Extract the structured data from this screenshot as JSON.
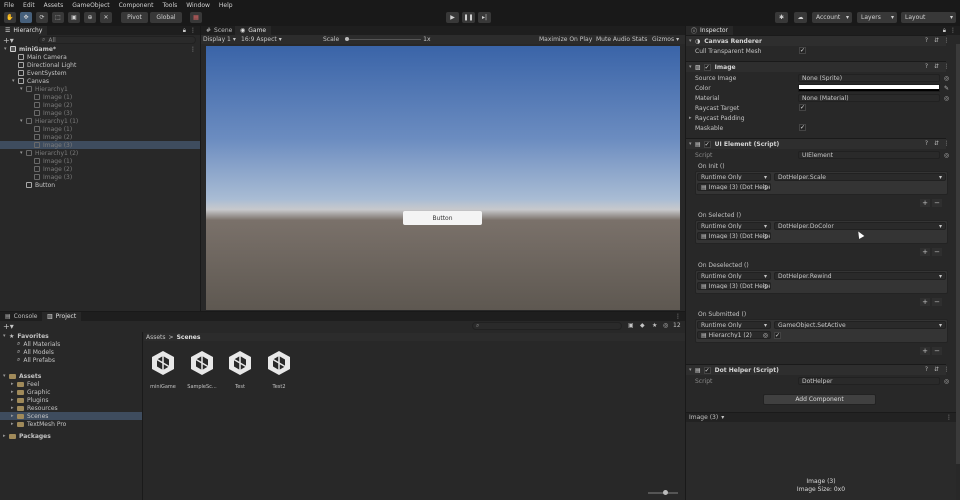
{
  "menu": [
    "File",
    "Edit",
    "Assets",
    "GameObject",
    "Component",
    "Tools",
    "Window",
    "Help"
  ],
  "toolbar": {
    "pivot": "Pivot",
    "global": "Global",
    "account": "Account",
    "layers": "Layers",
    "layout": "Layout"
  },
  "hierarchy": {
    "tab": "Hierarchy",
    "search_placeholder": "All",
    "items": [
      {
        "label": "miniGame*",
        "level": 0,
        "kind": "scene"
      },
      {
        "label": "Main Camera",
        "level": 1,
        "kind": "go"
      },
      {
        "label": "Directional Light",
        "level": 1,
        "kind": "go"
      },
      {
        "label": "EventSystem",
        "level": 1,
        "kind": "go"
      },
      {
        "label": "Canvas",
        "level": 1,
        "kind": "go"
      },
      {
        "label": "Hierarchy1",
        "level": 2,
        "kind": "dim"
      },
      {
        "label": "Image (1)",
        "level": 3,
        "kind": "dim"
      },
      {
        "label": "Image (2)",
        "level": 3,
        "kind": "dim"
      },
      {
        "label": "Image (3)",
        "level": 3,
        "kind": "dim"
      },
      {
        "label": "Hierarchy1 (1)",
        "level": 2,
        "kind": "dim"
      },
      {
        "label": "Image (1)",
        "level": 3,
        "kind": "dim"
      },
      {
        "label": "Image (2)",
        "level": 3,
        "kind": "dim"
      },
      {
        "label": "Image (3)",
        "level": 3,
        "kind": "dimsel"
      },
      {
        "label": "Hierarchy1 (2)",
        "level": 2,
        "kind": "dim"
      },
      {
        "label": "Image (1)",
        "level": 3,
        "kind": "dim"
      },
      {
        "label": "Image (2)",
        "level": 3,
        "kind": "dim"
      },
      {
        "label": "Image (3)",
        "level": 3,
        "kind": "dim"
      },
      {
        "label": "Button",
        "level": 2,
        "kind": "go"
      }
    ]
  },
  "view": {
    "tab_scene": "Scene",
    "tab_game": "Game",
    "display": "Display 1",
    "aspect": "16:9 Aspect",
    "scale_label": "Scale",
    "scale_value": "1x",
    "maximize": "Maximize On Play",
    "mute": "Mute Audio",
    "stats": "Stats",
    "gizmos": "Gizmos",
    "button_label": "Button"
  },
  "bottom": {
    "tab_console": "Console",
    "tab_project": "Project",
    "badge": "12",
    "breadcrumb_root": "Assets",
    "breadcrumb_sep": ">",
    "breadcrumb_current": "Scenes",
    "tree": [
      {
        "label": "Favorites",
        "level": 0,
        "kind": "star"
      },
      {
        "label": "All Materials",
        "level": 1,
        "kind": "search"
      },
      {
        "label": "All Models",
        "level": 1,
        "kind": "search"
      },
      {
        "label": "All Prefabs",
        "level": 1,
        "kind": "search"
      },
      {
        "label": "Assets",
        "level": 0,
        "kind": "folder"
      },
      {
        "label": "Feel",
        "level": 1,
        "kind": "folder"
      },
      {
        "label": "Graphic",
        "level": 1,
        "kind": "folder"
      },
      {
        "label": "Plugins",
        "level": 1,
        "kind": "folder"
      },
      {
        "label": "Resources",
        "level": 1,
        "kind": "folder"
      },
      {
        "label": "Scenes",
        "level": 1,
        "kind": "foldersel"
      },
      {
        "label": "TextMesh Pro",
        "level": 1,
        "kind": "folder"
      },
      {
        "label": "Packages",
        "level": 0,
        "kind": "folder"
      }
    ],
    "assets": [
      "miniGame",
      "SampleSc...",
      "Test",
      "Test2"
    ]
  },
  "inspector": {
    "tab": "Inspector",
    "canvas_renderer": "Canvas Renderer",
    "cull_label": "Cull Transparent Mesh",
    "image_title": "Image",
    "source_image_label": "Source Image",
    "source_image_value": "None (Sprite)",
    "color_label": "Color",
    "material_label": "Material",
    "material_value": "None (Material)",
    "raycast_target": "Raycast Target",
    "raycast_padding": "Raycast Padding",
    "maskable": "Maskable",
    "ui_element_title": "UI Element (Script)",
    "script_label": "Script",
    "ui_script_value": "UIElement",
    "events": [
      {
        "label": "On Init ()",
        "mode": "Runtime Only",
        "func": "DotHelper.Scale",
        "target": "Image (3) (Dot Helpe"
      },
      {
        "label": "On Selected ()",
        "mode": "Runtime Only",
        "func": "DotHelper.DoColor",
        "target": "Image (3) (Dot Helpe"
      },
      {
        "label": "On Deselected ()",
        "mode": "Runtime Only",
        "func": "DotHelper.Rewind",
        "target": "Image (3) (Dot Helpe"
      },
      {
        "label": "On Submitted ()",
        "mode": "Runtime Only",
        "func": "GameObject.SetActive",
        "target": "Hierarchy1 (2)"
      }
    ],
    "dot_helper_title": "Dot Helper (Script)",
    "dot_script_value": "DotHelper",
    "add_component": "Add Component",
    "preview_title": "Image (3)",
    "preview_name": "Image (3)",
    "preview_size": "Image Size: 0x0"
  },
  "colors": {
    "accent_blue": "#46607c",
    "selection": "#3e4c5e",
    "panel": "#282828"
  }
}
